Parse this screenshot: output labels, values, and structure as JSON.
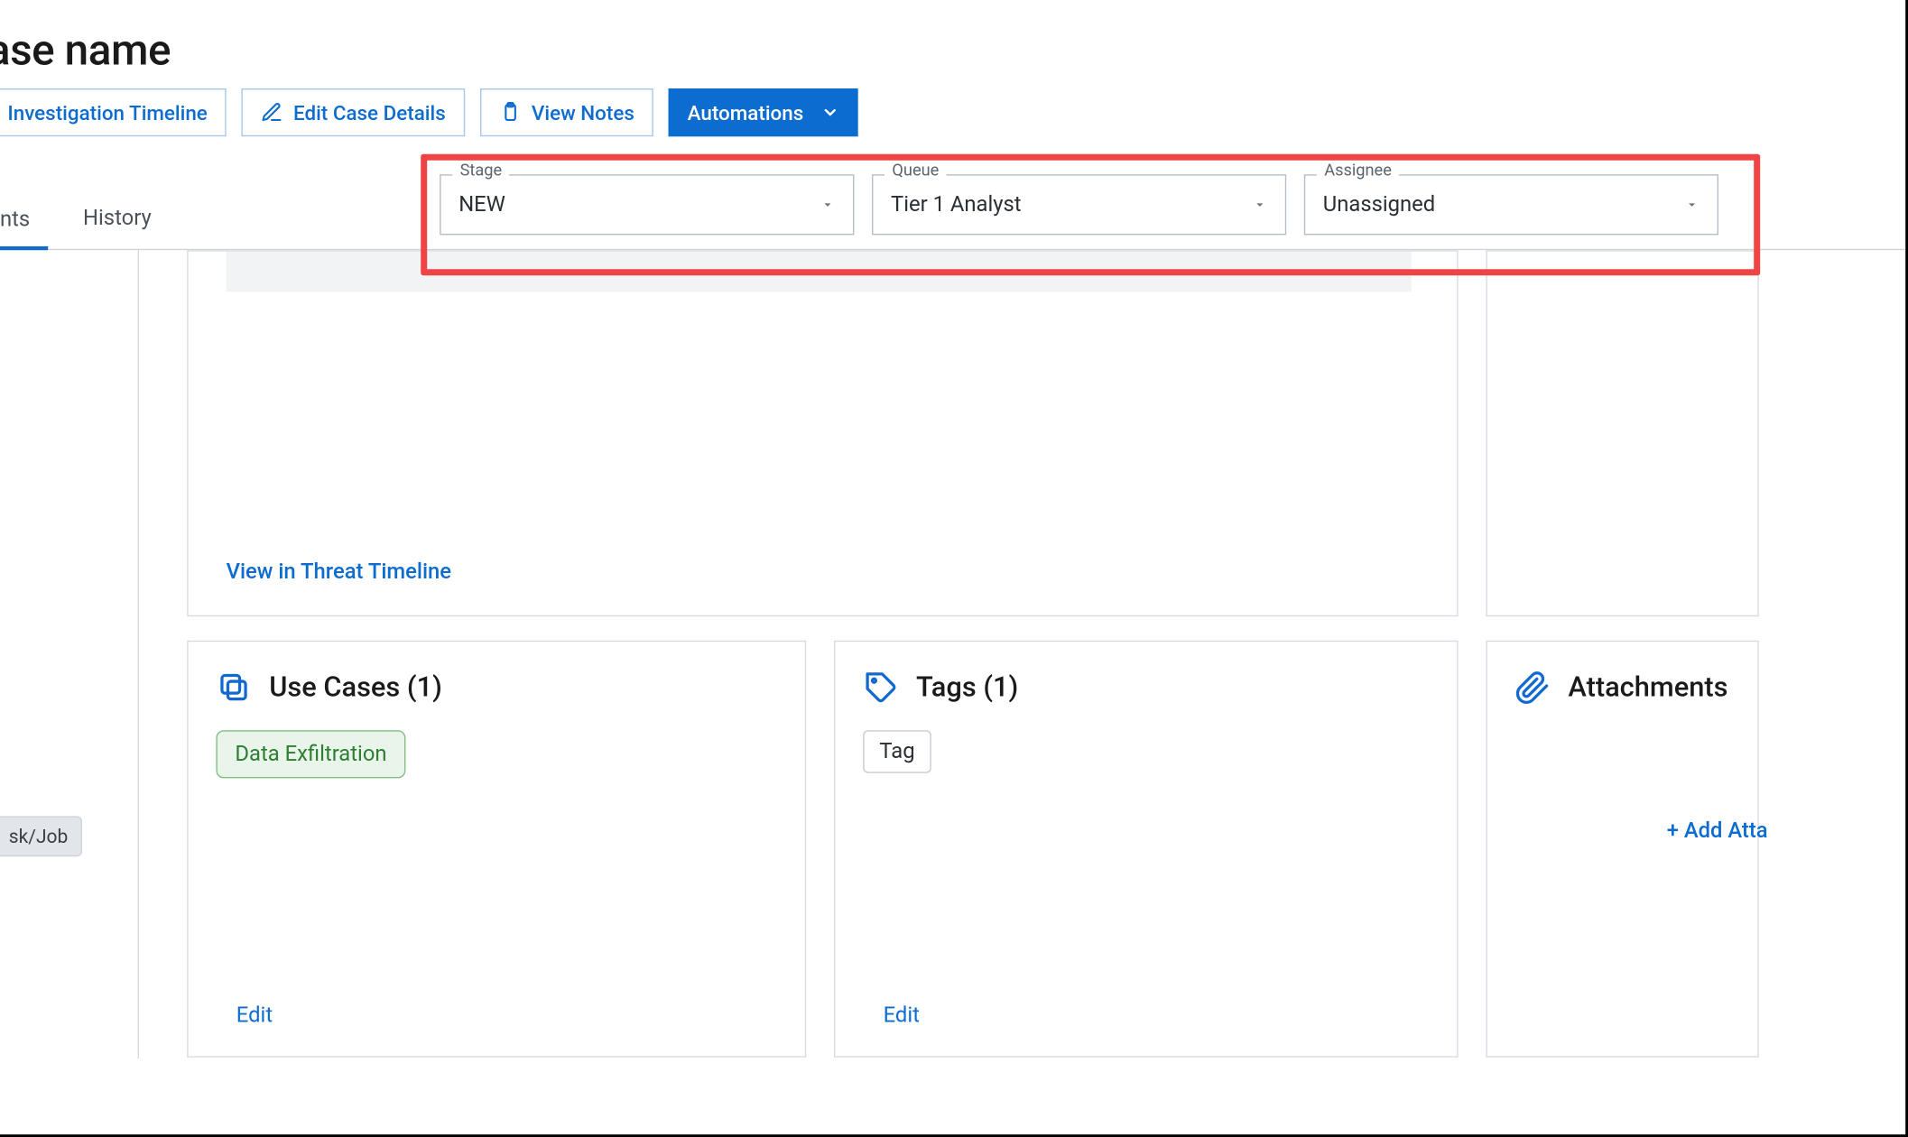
{
  "page_title": "Case name",
  "toolbar": {
    "investigation_timeline": "Investigation Timeline",
    "edit_case_details": "Edit Case Details",
    "view_notes": "View Notes",
    "automations": "Automations"
  },
  "tabs": {
    "first_partial": "nts",
    "history": "History"
  },
  "selects": {
    "stage": {
      "label": "Stage",
      "value": "NEW"
    },
    "queue": {
      "label": "Queue",
      "value": "Tier 1 Analyst"
    },
    "assignee": {
      "label": "Assignee",
      "value": "Unassigned"
    }
  },
  "left_strip": {
    "task_job_partial": "sk/Job"
  },
  "timeline": {
    "link": "View in Threat Timeline"
  },
  "cards": {
    "usecases": {
      "title": "Use Cases (1)",
      "chip": "Data Exfiltration",
      "edit": "Edit"
    },
    "tags": {
      "title": "Tags (1)",
      "chip": "Tag",
      "edit": "Edit"
    },
    "attachments": {
      "title": "Attachments",
      "add": "+ Add Atta"
    }
  }
}
